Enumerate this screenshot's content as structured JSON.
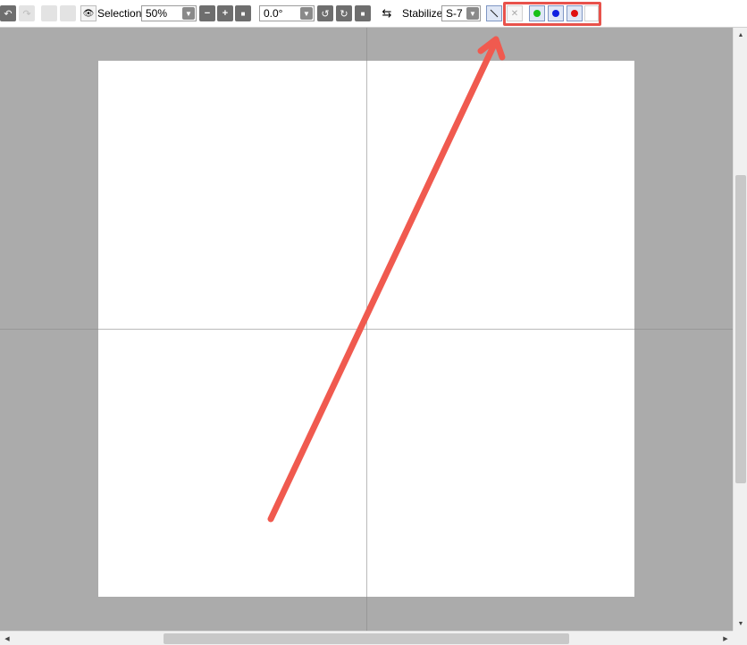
{
  "toolbar": {
    "undo_icon": "undo-icon",
    "redo_icon": "redo-icon",
    "view_label": "Selection",
    "zoom_value": "50%",
    "zoom_out_icon": "minus-icon",
    "zoom_in_icon": "plus-icon",
    "zoom_fit_icon": "square-icon",
    "angle_value": "0.0°",
    "rotate_left_icon": "rotate-left-icon",
    "rotate_right_icon": "rotate-right-icon",
    "rotate_reset_icon": "square-icon",
    "flip_icon": "flip-horizontal-icon",
    "stabilizer_label": "Stabilizer",
    "stabilizer_value": "S-7",
    "line_icon": "line-icon",
    "hide_icon": "hide-icon",
    "colors": {
      "green": "#18c018",
      "blue": "#1020e0",
      "red": "#e01010"
    }
  },
  "annotation": {
    "arrow_color": "#f05a4f",
    "highlight_color": "#e8524b"
  }
}
